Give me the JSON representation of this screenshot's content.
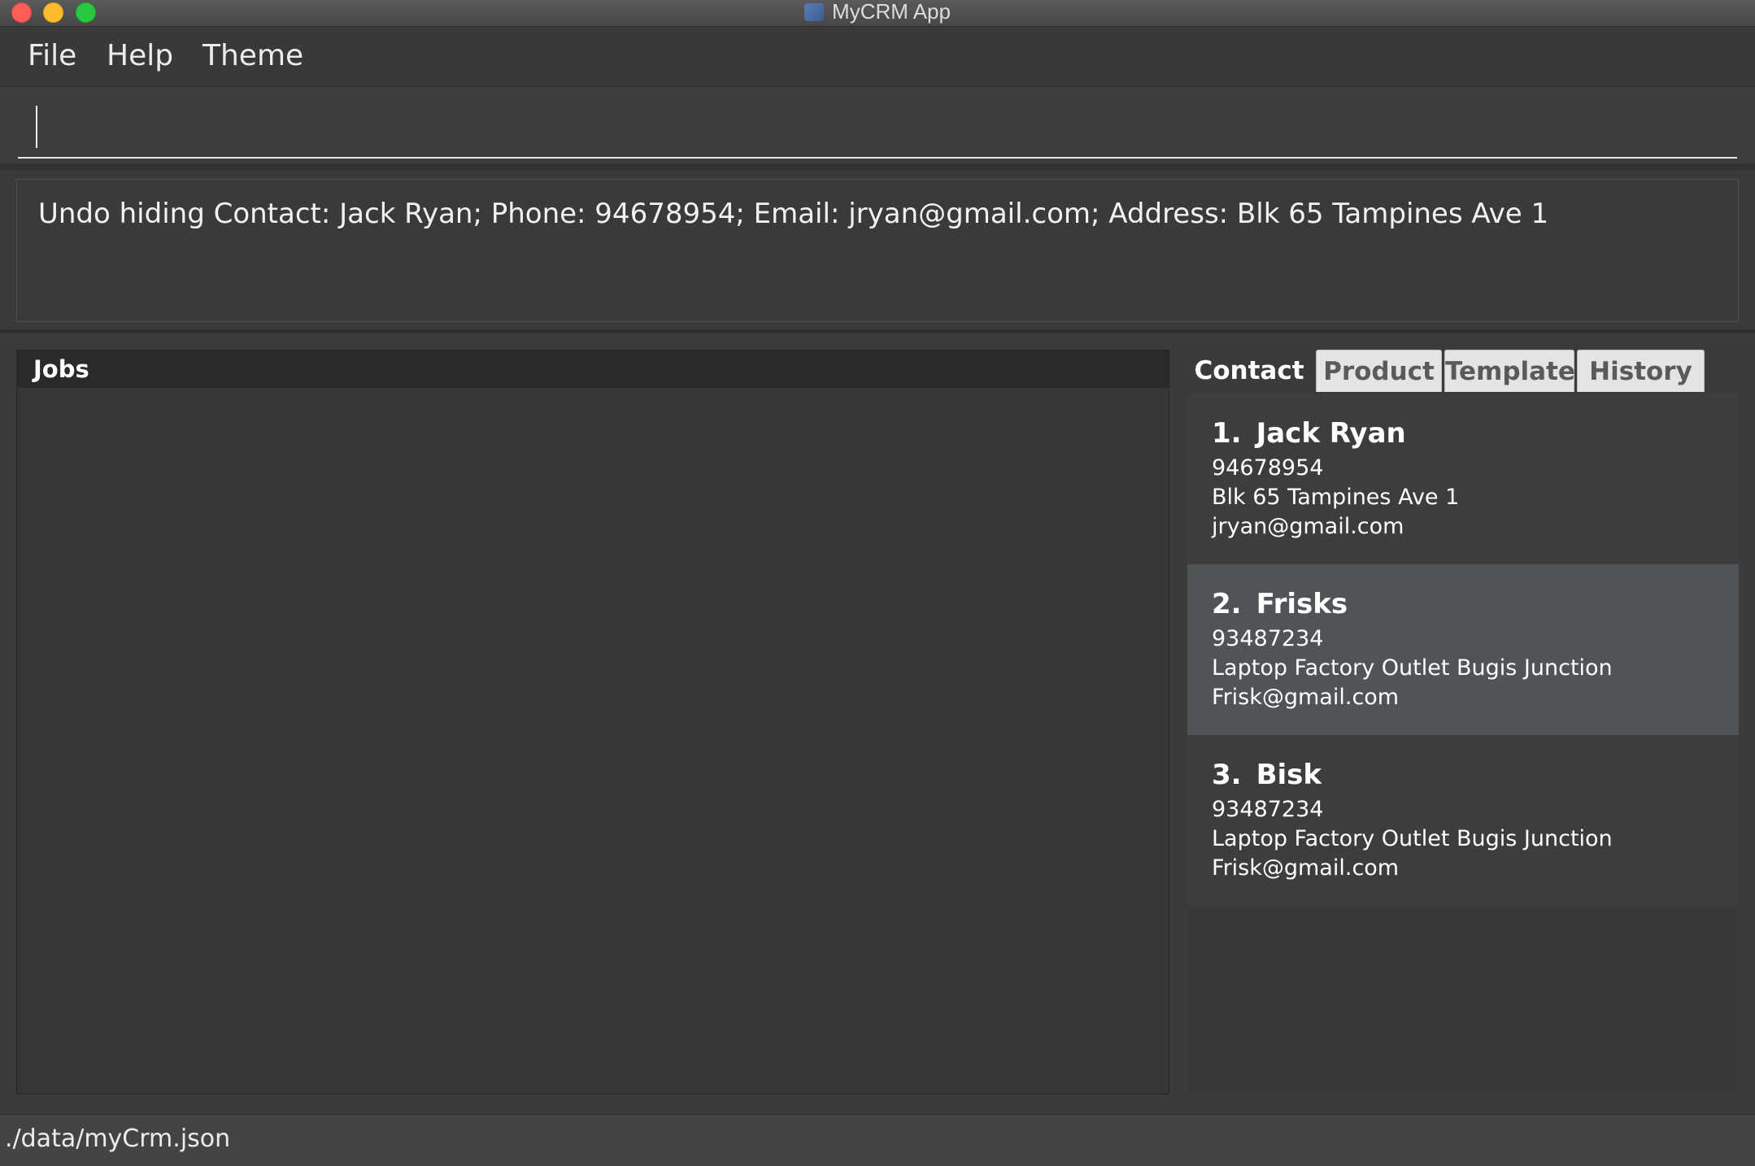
{
  "window": {
    "title": "MyCRM App",
    "icon": "app-icon"
  },
  "menu": {
    "file": "File",
    "help": "Help",
    "theme": "Theme"
  },
  "command": {
    "value": "",
    "placeholder": ""
  },
  "result": {
    "text": "Undo hiding Contact: Jack Ryan; Phone: 94678954; Email: jryan@gmail.com; Address: Blk 65 Tampines Ave 1"
  },
  "jobs": {
    "title": "Jobs"
  },
  "tabs": [
    {
      "label": "Contact",
      "active": true
    },
    {
      "label": "Product",
      "active": false
    },
    {
      "label": "Template",
      "active": false
    },
    {
      "label": "History",
      "active": false
    }
  ],
  "contacts": [
    {
      "index": "1.",
      "name": "Jack Ryan",
      "phone": "94678954",
      "address": "Blk 65 Tampines Ave 1",
      "email": "jryan@gmail.com",
      "selected": false
    },
    {
      "index": "2.",
      "name": "Frisks",
      "phone": "93487234",
      "address": "Laptop Factory Outlet Bugis Junction",
      "email": "Frisk@gmail.com",
      "selected": true
    },
    {
      "index": "3.",
      "name": "Bisk",
      "phone": "93487234",
      "address": "Laptop Factory Outlet Bugis Junction",
      "email": "Frisk@gmail.com",
      "selected": false
    }
  ],
  "status": {
    "path": "./data/myCrm.json"
  },
  "colors": {
    "background": "#3b3b3b",
    "selected_card": "#4f5457",
    "jobs_header": "#2a2a2a",
    "inactive_tab": "#e4e4e4"
  }
}
